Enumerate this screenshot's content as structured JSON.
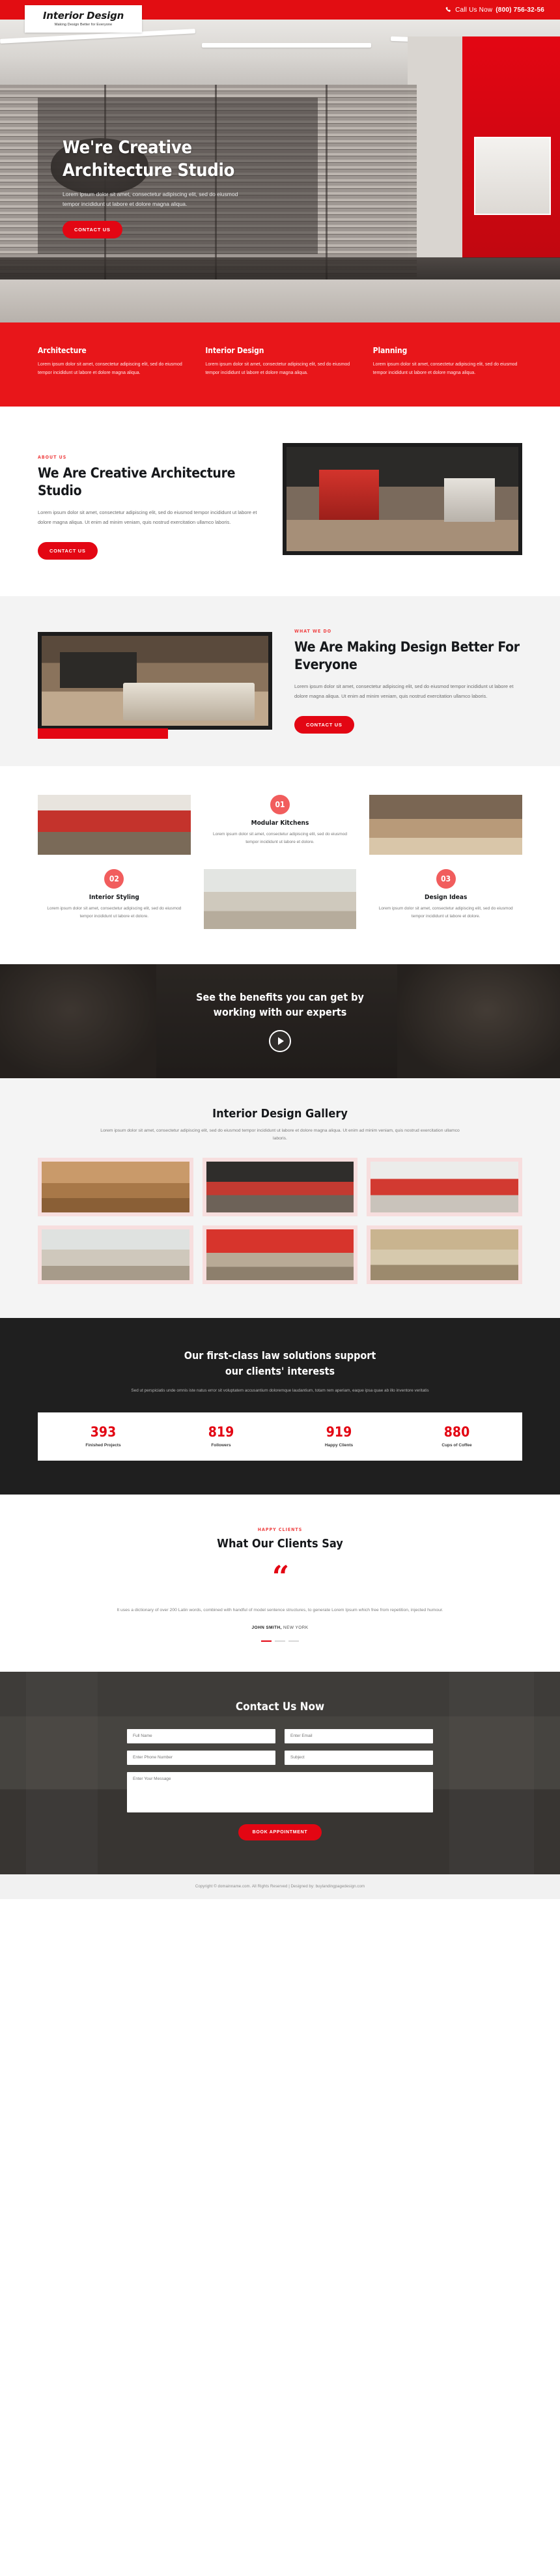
{
  "topbar": {
    "call_label": "Call Us Now",
    "phone": "(800) 756-32-56",
    "phone_icon": "phone-icon"
  },
  "logo": {
    "title": "Interior Design",
    "tagline": "Making Design Better for Everyone"
  },
  "hero": {
    "heading_line1": "We're Creative",
    "heading_line2": "Architecture Studio",
    "paragraph": "Lorem ipsum dolor sit amet, consectetur adipiscing elit, sed do eiusmod tempor incididunt ut labore et dolore magna aliqua.",
    "cta": "CONTACT US"
  },
  "services": [
    {
      "title": "Architecture",
      "text": "Lorem ipsum dolor sit amet, consectetur adipiscing elit, sed do eiusmod tempor incididunt ut labore et dolore magna aliqua."
    },
    {
      "title": "Interior Design",
      "text": "Lorem ipsum dolor sit amet, consectetur adipiscing elit, sed do eiusmod tempor incididunt ut labore et dolore magna aliqua."
    },
    {
      "title": "Planning",
      "text": "Lorem ipsum dolor sit amet, consectetur adipiscing elit, sed do eiusmod tempor incididunt ut labore et dolore magna aliqua."
    }
  ],
  "about": {
    "eyebrow": "ABOUT US",
    "heading": "We Are Creative Architecture Studio",
    "paragraph": "Lorem ipsum dolor sit amet, consectetur adipiscing elit, sed do eiusmod tempor incididunt ut labore et dolore magna aliqua. Ut enim ad minim veniam, quis nostrud exercitation ullamco laboris.",
    "cta": "CONTACT US"
  },
  "whatwedo": {
    "eyebrow": "WHAT WE DO",
    "heading": "We Are Making Design Better For Everyone",
    "paragraph": "Lorem ipsum dolor sit amet, consectetur adipiscing elit, sed do eiusmod tempor incididunt ut labore et dolore magna aliqua. Ut enim ad minim veniam, quis nostrud exercitation ullamco laboris.",
    "cta": "CONTACT US"
  },
  "features": [
    {
      "number": "01",
      "title": "Modular Kitchens",
      "text": "Lorem ipsum dolor sit amet, consectetur adipiscing elit, sed do eiusmod tempor incididunt ut labore et dolore."
    },
    {
      "number": "02",
      "title": "Interior Styling",
      "text": "Lorem ipsum dolor sit amet, consectetur adipiscing elit, sed do eiusmod tempor incididunt ut labore et dolore."
    },
    {
      "number": "03",
      "title": "Design Ideas",
      "text": "Lorem ipsum dolor sit amet, consectetur adipiscing elit, sed do eiusmod tempor incididunt ut labore et dolore."
    }
  ],
  "video": {
    "heading_line1": "See the benefits you can get by",
    "heading_line2": "working with our experts",
    "play_icon": "play-icon"
  },
  "gallery": {
    "heading": "Interior Design Gallery",
    "paragraph": "Lorem ipsum dolor sit amet, consectetur adipiscing elit, sed do eiusmod tempor incididunt ut labore et dolore magna aliqua. Ut enim ad minim veniam, quis nostrud exercitation ullamco laboris.",
    "items": [
      "gallery-image-1",
      "gallery-image-2",
      "gallery-image-3",
      "gallery-image-4",
      "gallery-image-5",
      "gallery-image-6"
    ]
  },
  "stats": {
    "heading_line1": "Our first-class law solutions support",
    "heading_line2": "our clients' interests",
    "paragraph": "Sed ut perspiciatis unde omnis iste natus error sit voluptatem accusantium doloremque laudantium, totam rem aperiam, eaque ipsa quae ab illo inventore veritatis",
    "counters": [
      {
        "value": "393",
        "label": "Finished Projects"
      },
      {
        "value": "819",
        "label": "Followers"
      },
      {
        "value": "919",
        "label": "Happy Clients"
      },
      {
        "value": "880",
        "label": "Cups of Coffee"
      }
    ]
  },
  "testimonial": {
    "eyebrow": "HAPPY CLIENTS",
    "heading": "What Our Clients Say",
    "quote_glyph": "“",
    "body": "It uses a dictionary of over 200 Latin words, combined with handful of model sentence structures, to generate Lorem Ipsum which free from repetition, injected humour.",
    "author_name": "JOHN SMITH,",
    "author_location": "NEW YORK",
    "slides": 3,
    "active_slide": 0
  },
  "contact": {
    "heading": "Contact Us Now",
    "fields": {
      "full_name": {
        "placeholder": "Full Name",
        "value": ""
      },
      "email": {
        "placeholder": "Enter Email",
        "value": ""
      },
      "phone": {
        "placeholder": "Enter Phone Number",
        "value": ""
      },
      "subject": {
        "placeholder": "Subject",
        "value": ""
      },
      "message": {
        "placeholder": "Enter Your Message",
        "value": ""
      }
    },
    "submit": "BOOK APPOINTMENT"
  },
  "footer": {
    "text": "Copyright © domainname.com. All Rights Reserved | Designed by: buylandingpagedesign.com"
  },
  "colors": {
    "brand_red": "#e30613",
    "bar_red": "#e8161a",
    "accent_pink": "#f15d5d",
    "dark": "#1f1f1f"
  }
}
